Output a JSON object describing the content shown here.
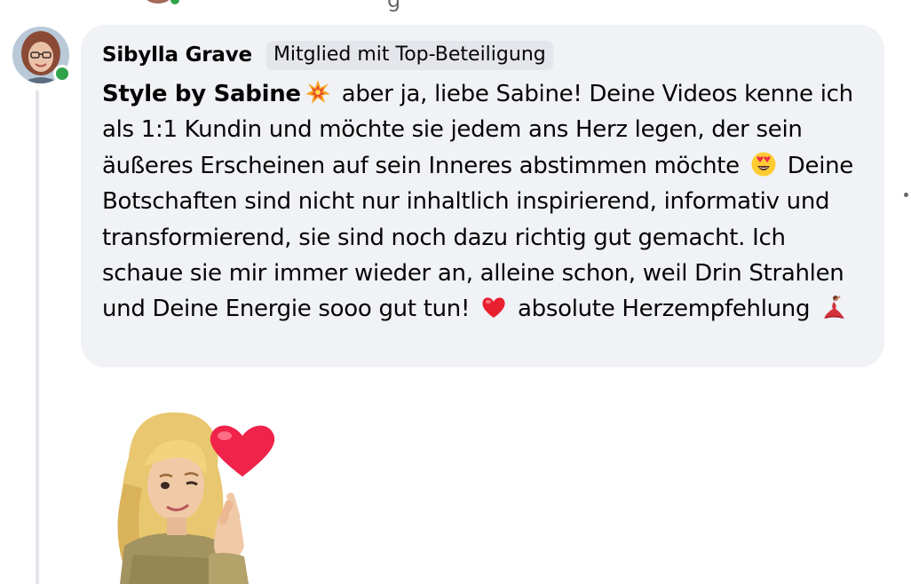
{
  "previous_comment": {
    "fragment": "g"
  },
  "comment": {
    "author": "Sibylla Grave",
    "badge": "Mitglied mit Top-Beteiligung",
    "mention": "Style by Sabine",
    "segments": [
      " aber ja, liebe Sabine! Deine Videos kenne ich als 1:1 Kundin und möchte sie jedem ans Herz legen, der sein äußeres Erscheinen auf sein Inneres abstimmen möchte ",
      " Deine Botschaften sind nicht nur inhaltlich inspirierend, informativ und transformierend, sie sind noch dazu richtig gut gemacht. Ich schaue sie mir immer wieder an, alleine schon, weil Drin Strahlen und Deine Energie sooo gut tun! ",
      " absolute Herzempfehlung "
    ],
    "emojis": [
      "collision-emoji",
      "heart-eyes-emoji",
      "red-heart-emoji",
      "dancer-emoji"
    ]
  },
  "sticker": {
    "name": "avatar-heart-sticker"
  },
  "colors": {
    "bubble_bg": "#f0f2f5",
    "badge_bg": "#e4e6eb",
    "online_green": "#31a24c",
    "text": "#050505"
  }
}
